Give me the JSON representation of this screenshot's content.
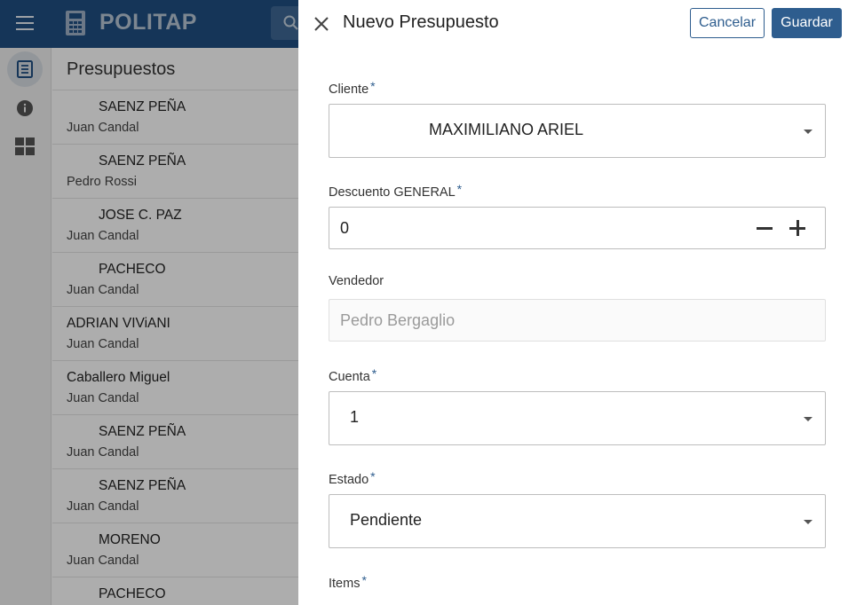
{
  "app": {
    "title": "POLITAP"
  },
  "list": {
    "header": "Presupuestos",
    "items": [
      {
        "title": "SAENZ PEÑA",
        "subtitle": "Juan Candal",
        "indent": true
      },
      {
        "title": "SAENZ PEÑA",
        "subtitle": "Pedro Rossi",
        "indent": true
      },
      {
        "title": "JOSE C. PAZ",
        "subtitle": "Juan Candal",
        "indent": true
      },
      {
        "title": "PACHECO",
        "subtitle": "Juan Candal",
        "indent": true
      },
      {
        "title": "ADRIAN VIViANI",
        "subtitle": "Juan Candal",
        "indent": false
      },
      {
        "title": "Caballero Miguel",
        "subtitle": "Juan Candal",
        "indent": false
      },
      {
        "title": "SAENZ PEÑA",
        "subtitle": "Juan Candal",
        "indent": true
      },
      {
        "title": "SAENZ PEÑA",
        "subtitle": "Juan Candal",
        "indent": true
      },
      {
        "title": "MORENO",
        "subtitle": "Juan Candal",
        "indent": true
      },
      {
        "title": "PACHECO",
        "subtitle": "",
        "indent": true
      }
    ]
  },
  "modal": {
    "title": "Nuevo Presupuesto",
    "cancel_label": "Cancelar",
    "save_label": "Guardar",
    "required_mark": "*",
    "cliente": {
      "label": "Cliente",
      "value": "MAXIMILIANO ARIEL"
    },
    "descuento": {
      "label": "Descuento GENERAL",
      "value": "0"
    },
    "vendedor": {
      "label": "Vendedor",
      "placeholder": "Pedro Bergaglio"
    },
    "cuenta": {
      "label": "Cuenta",
      "value": "1"
    },
    "estado": {
      "label": "Estado",
      "value": "Pendiente"
    },
    "items": {
      "label": "Items"
    }
  },
  "colors": {
    "topbar": "#1f4f82",
    "primary": "#2e5d8e",
    "overlay": "rgba(0,0,0,0.32)"
  }
}
